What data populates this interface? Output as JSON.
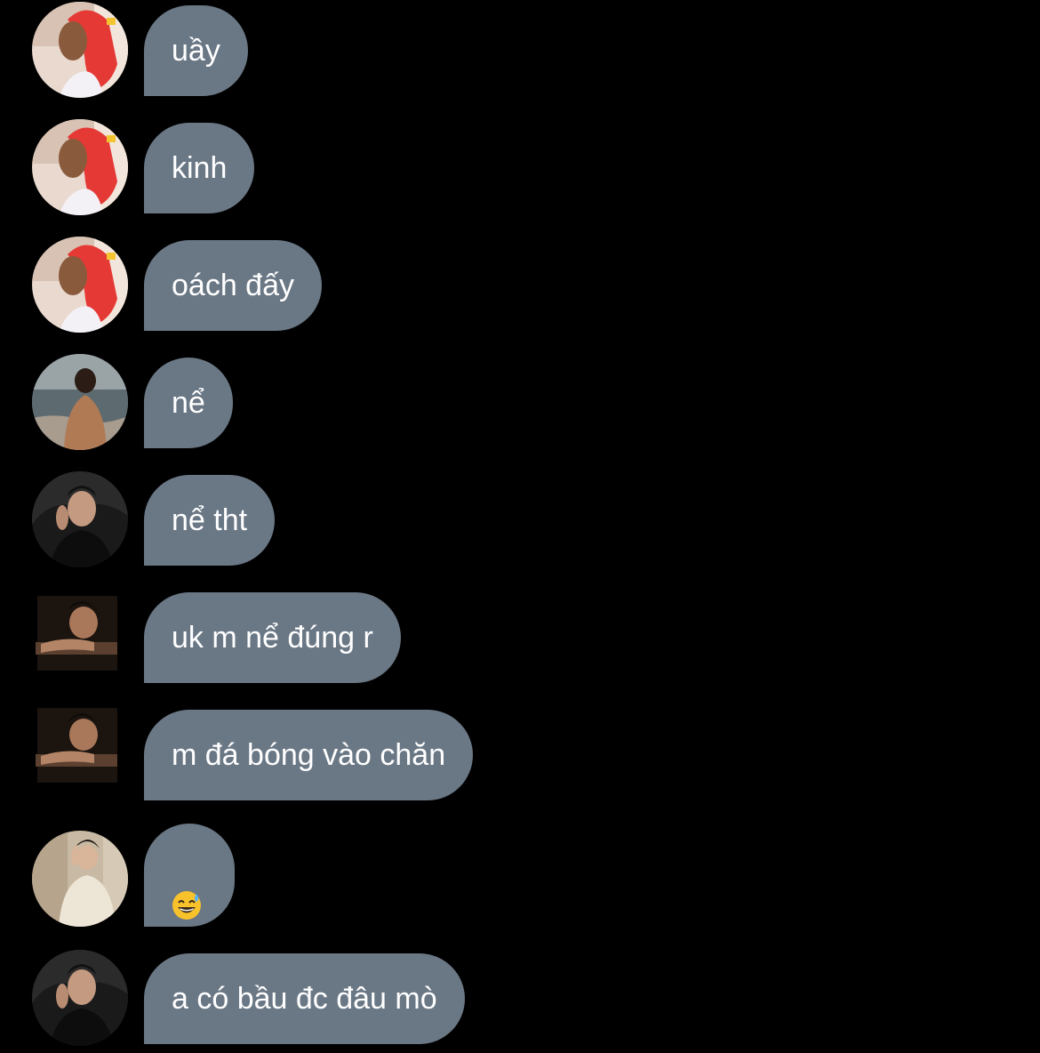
{
  "colors": {
    "background": "#000000",
    "bubble": "#6a7785",
    "bubble_text": "#ffffff"
  },
  "messages": [
    {
      "avatar": "red-scarf-avatar",
      "text": "uầy"
    },
    {
      "avatar": "red-scarf-avatar",
      "text": "kinh"
    },
    {
      "avatar": "red-scarf-avatar",
      "text": "oách đấy"
    },
    {
      "avatar": "beach-avatar",
      "text": "nể"
    },
    {
      "avatar": "dark-portrait-avatar",
      "text": "nể tht"
    },
    {
      "avatar": "leaning-portrait-avatar",
      "text": "uk m nể đúng r"
    },
    {
      "avatar": "leaning-portrait-avatar",
      "text": "m đá bóng vào chăn"
    },
    {
      "avatar": "white-sweater-avatar",
      "text": "",
      "emoji": "grinning-sweat-emoji"
    },
    {
      "avatar": "dark-portrait-avatar",
      "text": "a có bầu đc đâu mò"
    }
  ]
}
